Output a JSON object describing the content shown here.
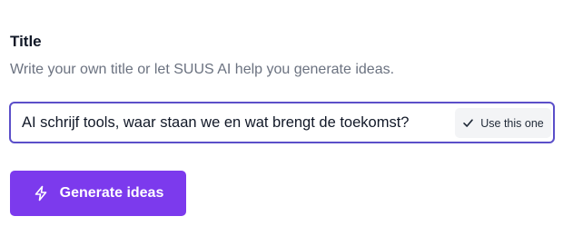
{
  "field": {
    "title": "Title",
    "help": "Write your own title or let SUUS AI help you generate ideas.",
    "value": "AI schrijf tools, waar staan we en wat brengt de toekomst?",
    "use_label": "Use this one",
    "use_icon": "check-icon"
  },
  "actions": {
    "generate_label": "Generate ideas",
    "generate_icon": "lightning-bolt-icon"
  },
  "colors": {
    "accent": "#7c3aed",
    "focus_border": "#5b4fc9",
    "help_text": "#6b7280"
  }
}
